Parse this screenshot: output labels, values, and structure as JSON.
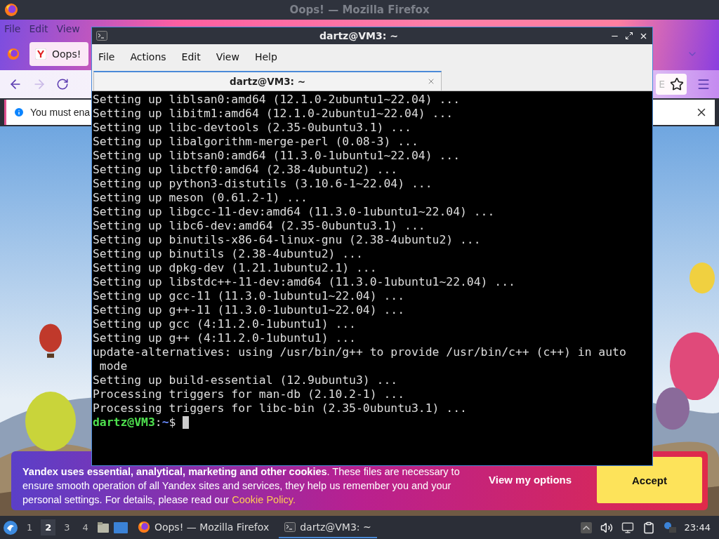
{
  "firefox": {
    "title": "Oops! — Mozilla Firefox",
    "menu": [
      "File",
      "Edit",
      "View"
    ],
    "tab": {
      "title": "Oops!"
    },
    "url_fragment": "E",
    "notification": "You must ena",
    "cookie_banner": {
      "text": "**Yandex uses essential, analytical, marketing and other cookies**. These files are necessary to ensure smooth operation of all Yandex sites and services, they help us remember you and your personal settings. For details, please read our",
      "link": "Cookie Policy.",
      "options_button": "View my options",
      "accept_button": "Accept"
    }
  },
  "terminal": {
    "title": "dartz@VM3: ~",
    "menu": [
      "File",
      "Actions",
      "Edit",
      "View",
      "Help"
    ],
    "tab": "dartz@VM3: ~",
    "lines": [
      "Setting up liblsan0:amd64 (12.1.0-2ubuntu1~22.04) ...",
      "Setting up libitm1:amd64 (12.1.0-2ubuntu1~22.04) ...",
      "Setting up libc-devtools (2.35-0ubuntu3.1) ...",
      "Setting up libalgorithm-merge-perl (0.08-3) ...",
      "Setting up libtsan0:amd64 (11.3.0-1ubuntu1~22.04) ...",
      "Setting up libctf0:amd64 (2.38-4ubuntu2) ...",
      "Setting up python3-distutils (3.10.6-1~22.04) ...",
      "Setting up meson (0.61.2-1) ...",
      "Setting up libgcc-11-dev:amd64 (11.3.0-1ubuntu1~22.04) ...",
      "Setting up libc6-dev:amd64 (2.35-0ubuntu3.1) ...",
      "Setting up binutils-x86-64-linux-gnu (2.38-4ubuntu2) ...",
      "Setting up binutils (2.38-4ubuntu2) ...",
      "Setting up dpkg-dev (1.21.1ubuntu2.1) ...",
      "Setting up libstdc++-11-dev:amd64 (11.3.0-1ubuntu1~22.04) ...",
      "Setting up gcc-11 (11.3.0-1ubuntu1~22.04) ...",
      "Setting up g++-11 (11.3.0-1ubuntu1~22.04) ...",
      "Setting up gcc (4:11.2.0-1ubuntu1) ...",
      "Setting up g++ (4:11.2.0-1ubuntu1) ...",
      "update-alternatives: using /usr/bin/g++ to provide /usr/bin/c++ (c++) in auto",
      " mode",
      "Setting up build-essential (12.9ubuntu3) ...",
      "Processing triggers for man-db (2.10.2-1) ...",
      "Processing triggers for libc-bin (2.35-0ubuntu3.1) ..."
    ],
    "prompt": {
      "user_host": "dartz@VM3",
      "separator": ":",
      "path": "~",
      "symbol": "$"
    }
  },
  "taskbar": {
    "workspaces": [
      {
        "label": "1",
        "selected": false
      },
      {
        "label": "2",
        "selected": true
      },
      {
        "label": "3",
        "selected": false
      },
      {
        "label": "4",
        "selected": false
      }
    ],
    "tasks": [
      {
        "label": "Oops! — Mozilla Firefox",
        "kind": "firefox",
        "selected": false
      },
      {
        "label": "dartz@VM3: ~",
        "kind": "terminal",
        "selected": true
      }
    ],
    "clock": "23:44"
  }
}
